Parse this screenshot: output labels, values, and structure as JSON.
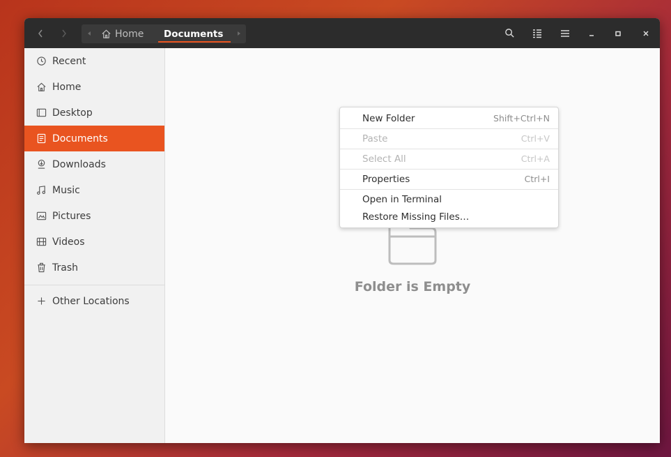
{
  "colors": {
    "accent": "#e95420",
    "headerbar": "#2c2c2c",
    "sidebar": "#f1f1f1"
  },
  "header": {
    "back_icon": "chevron-left-icon",
    "forward_icon": "chevron-right-icon",
    "breadcrumb": {
      "home_label": "Home",
      "current_label": "Documents"
    },
    "tools": [
      "search-icon",
      "view-list-icon",
      "hamburger-menu-icon",
      "minimize-icon",
      "maximize-icon",
      "close-icon"
    ]
  },
  "sidebar": {
    "items": [
      {
        "label": "Recent",
        "icon": "clock-icon"
      },
      {
        "label": "Home",
        "icon": "home-icon"
      },
      {
        "label": "Desktop",
        "icon": "desktop-icon"
      },
      {
        "label": "Documents",
        "icon": "document-icon",
        "active": true
      },
      {
        "label": "Downloads",
        "icon": "download-icon"
      },
      {
        "label": "Music",
        "icon": "music-icon"
      },
      {
        "label": "Pictures",
        "icon": "picture-icon"
      },
      {
        "label": "Videos",
        "icon": "video-icon"
      },
      {
        "label": "Trash",
        "icon": "trash-icon"
      },
      {
        "label": "Other Locations",
        "icon": "plus-icon"
      }
    ]
  },
  "content": {
    "empty_text": "Folder is Empty"
  },
  "context_menu": {
    "items": [
      {
        "label": "New Folder",
        "shortcut": "Shift+Ctrl+N",
        "enabled": true
      },
      {
        "label": "Paste",
        "shortcut": "Ctrl+V",
        "enabled": false
      },
      {
        "label": "Select All",
        "shortcut": "Ctrl+A",
        "enabled": false
      },
      {
        "label": "Properties",
        "shortcut": "Ctrl+I",
        "enabled": true
      },
      {
        "label": "Open in Terminal",
        "shortcut": "",
        "enabled": true
      },
      {
        "label": "Restore Missing Files…",
        "shortcut": "",
        "enabled": true
      }
    ]
  }
}
